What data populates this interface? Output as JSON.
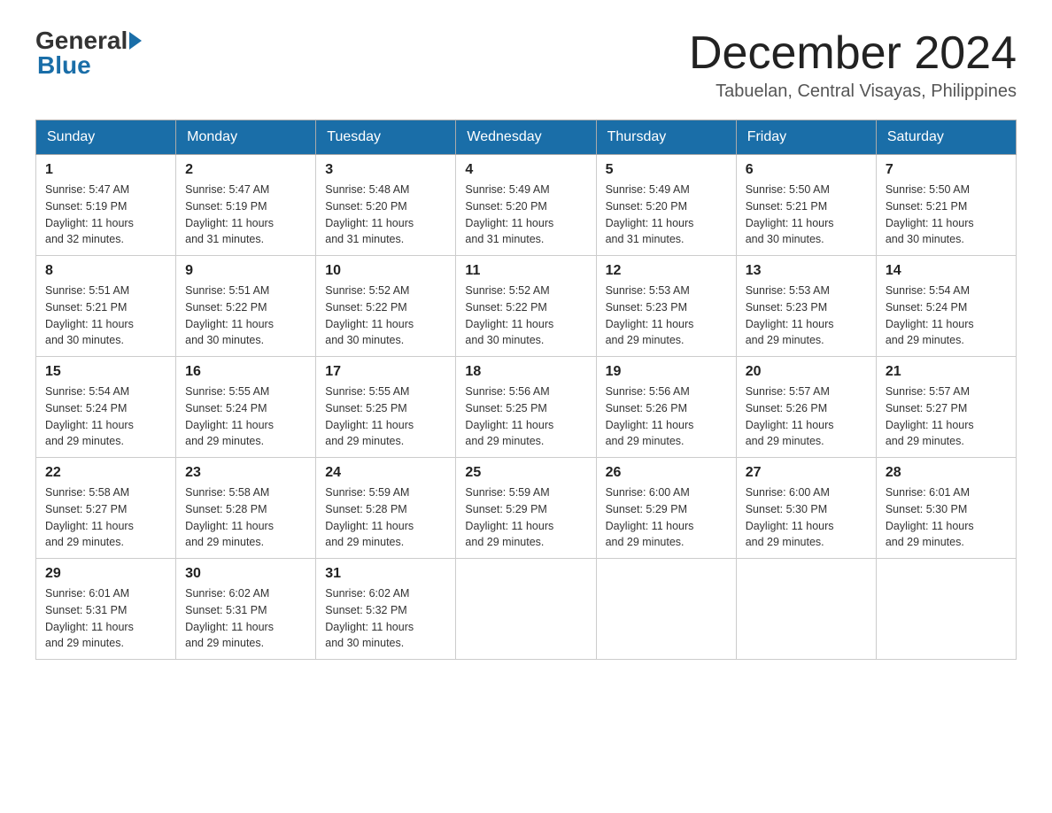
{
  "logo": {
    "general": "General",
    "blue": "Blue"
  },
  "title": {
    "month_year": "December 2024",
    "location": "Tabuelan, Central Visayas, Philippines"
  },
  "weekdays": [
    "Sunday",
    "Monday",
    "Tuesday",
    "Wednesday",
    "Thursday",
    "Friday",
    "Saturday"
  ],
  "weeks": [
    [
      {
        "day": "1",
        "sunrise": "5:47 AM",
        "sunset": "5:19 PM",
        "daylight": "11 hours and 32 minutes."
      },
      {
        "day": "2",
        "sunrise": "5:47 AM",
        "sunset": "5:19 PM",
        "daylight": "11 hours and 31 minutes."
      },
      {
        "day": "3",
        "sunrise": "5:48 AM",
        "sunset": "5:20 PM",
        "daylight": "11 hours and 31 minutes."
      },
      {
        "day": "4",
        "sunrise": "5:49 AM",
        "sunset": "5:20 PM",
        "daylight": "11 hours and 31 minutes."
      },
      {
        "day": "5",
        "sunrise": "5:49 AM",
        "sunset": "5:20 PM",
        "daylight": "11 hours and 31 minutes."
      },
      {
        "day": "6",
        "sunrise": "5:50 AM",
        "sunset": "5:21 PM",
        "daylight": "11 hours and 30 minutes."
      },
      {
        "day": "7",
        "sunrise": "5:50 AM",
        "sunset": "5:21 PM",
        "daylight": "11 hours and 30 minutes."
      }
    ],
    [
      {
        "day": "8",
        "sunrise": "5:51 AM",
        "sunset": "5:21 PM",
        "daylight": "11 hours and 30 minutes."
      },
      {
        "day": "9",
        "sunrise": "5:51 AM",
        "sunset": "5:22 PM",
        "daylight": "11 hours and 30 minutes."
      },
      {
        "day": "10",
        "sunrise": "5:52 AM",
        "sunset": "5:22 PM",
        "daylight": "11 hours and 30 minutes."
      },
      {
        "day": "11",
        "sunrise": "5:52 AM",
        "sunset": "5:22 PM",
        "daylight": "11 hours and 30 minutes."
      },
      {
        "day": "12",
        "sunrise": "5:53 AM",
        "sunset": "5:23 PM",
        "daylight": "11 hours and 29 minutes."
      },
      {
        "day": "13",
        "sunrise": "5:53 AM",
        "sunset": "5:23 PM",
        "daylight": "11 hours and 29 minutes."
      },
      {
        "day": "14",
        "sunrise": "5:54 AM",
        "sunset": "5:24 PM",
        "daylight": "11 hours and 29 minutes."
      }
    ],
    [
      {
        "day": "15",
        "sunrise": "5:54 AM",
        "sunset": "5:24 PM",
        "daylight": "11 hours and 29 minutes."
      },
      {
        "day": "16",
        "sunrise": "5:55 AM",
        "sunset": "5:24 PM",
        "daylight": "11 hours and 29 minutes."
      },
      {
        "day": "17",
        "sunrise": "5:55 AM",
        "sunset": "5:25 PM",
        "daylight": "11 hours and 29 minutes."
      },
      {
        "day": "18",
        "sunrise": "5:56 AM",
        "sunset": "5:25 PM",
        "daylight": "11 hours and 29 minutes."
      },
      {
        "day": "19",
        "sunrise": "5:56 AM",
        "sunset": "5:26 PM",
        "daylight": "11 hours and 29 minutes."
      },
      {
        "day": "20",
        "sunrise": "5:57 AM",
        "sunset": "5:26 PM",
        "daylight": "11 hours and 29 minutes."
      },
      {
        "day": "21",
        "sunrise": "5:57 AM",
        "sunset": "5:27 PM",
        "daylight": "11 hours and 29 minutes."
      }
    ],
    [
      {
        "day": "22",
        "sunrise": "5:58 AM",
        "sunset": "5:27 PM",
        "daylight": "11 hours and 29 minutes."
      },
      {
        "day": "23",
        "sunrise": "5:58 AM",
        "sunset": "5:28 PM",
        "daylight": "11 hours and 29 minutes."
      },
      {
        "day": "24",
        "sunrise": "5:59 AM",
        "sunset": "5:28 PM",
        "daylight": "11 hours and 29 minutes."
      },
      {
        "day": "25",
        "sunrise": "5:59 AM",
        "sunset": "5:29 PM",
        "daylight": "11 hours and 29 minutes."
      },
      {
        "day": "26",
        "sunrise": "6:00 AM",
        "sunset": "5:29 PM",
        "daylight": "11 hours and 29 minutes."
      },
      {
        "day": "27",
        "sunrise": "6:00 AM",
        "sunset": "5:30 PM",
        "daylight": "11 hours and 29 minutes."
      },
      {
        "day": "28",
        "sunrise": "6:01 AM",
        "sunset": "5:30 PM",
        "daylight": "11 hours and 29 minutes."
      }
    ],
    [
      {
        "day": "29",
        "sunrise": "6:01 AM",
        "sunset": "5:31 PM",
        "daylight": "11 hours and 29 minutes."
      },
      {
        "day": "30",
        "sunrise": "6:02 AM",
        "sunset": "5:31 PM",
        "daylight": "11 hours and 29 minutes."
      },
      {
        "day": "31",
        "sunrise": "6:02 AM",
        "sunset": "5:32 PM",
        "daylight": "11 hours and 30 minutes."
      },
      null,
      null,
      null,
      null
    ]
  ],
  "labels": {
    "sunrise": "Sunrise:",
    "sunset": "Sunset:",
    "daylight": "Daylight:"
  }
}
